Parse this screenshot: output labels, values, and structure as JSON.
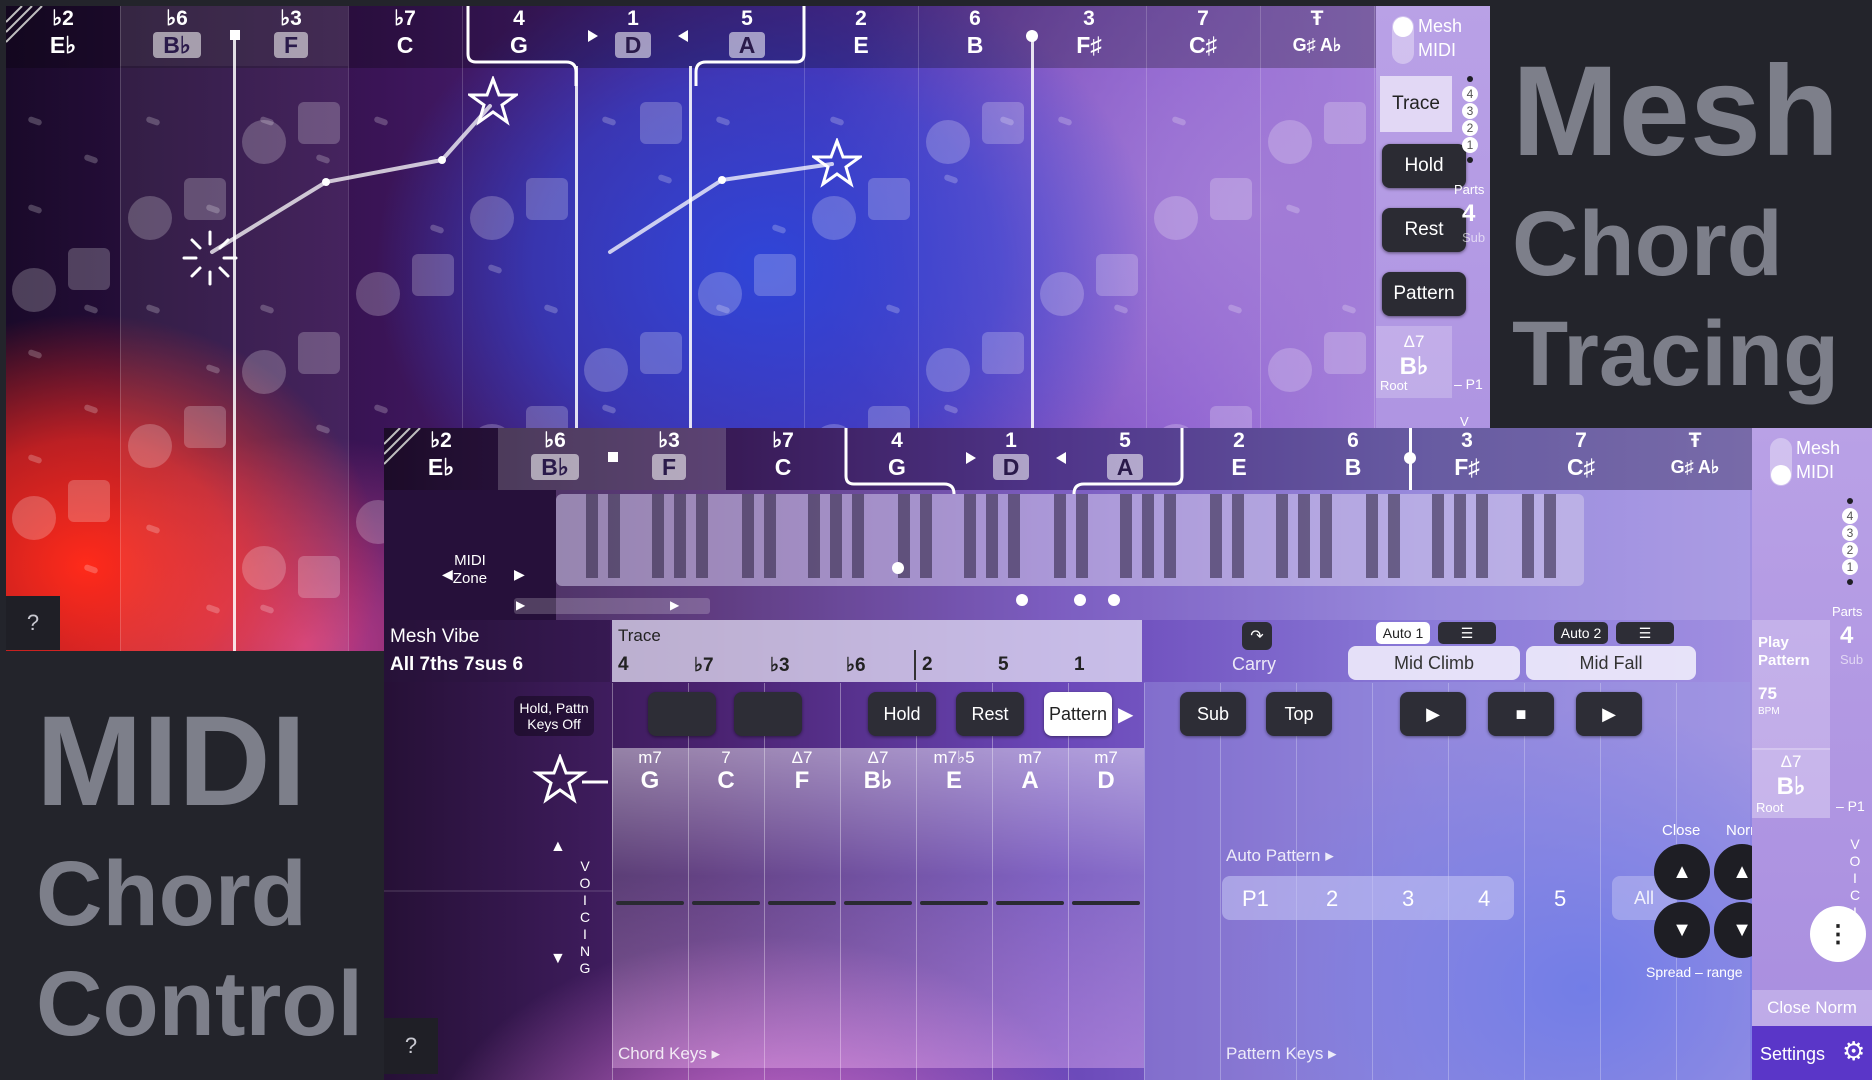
{
  "promo_top": {
    "line1": "Mesh",
    "line2": "Chord",
    "line3": "Tracing"
  },
  "promo_bottom": {
    "line1": "MIDI",
    "line2": "Chord",
    "line3": "Control"
  },
  "columns": [
    {
      "degree": "♭2",
      "note": "E♭",
      "boxed": false
    },
    {
      "degree": "♭6",
      "note": "B♭",
      "boxed": true
    },
    {
      "degree": "♭3",
      "note": "F",
      "boxed": true
    },
    {
      "degree": "♭7",
      "note": "C",
      "boxed": false
    },
    {
      "degree": "4",
      "note": "G",
      "boxed": false
    },
    {
      "degree": "1",
      "note": "D",
      "boxed": true
    },
    {
      "degree": "5",
      "note": "A",
      "boxed": true
    },
    {
      "degree": "2",
      "note": "E",
      "boxed": false
    },
    {
      "degree": "6",
      "note": "B",
      "boxed": false
    },
    {
      "degree": "3",
      "note": "F♯",
      "boxed": false
    },
    {
      "degree": "7",
      "note": "C♯",
      "boxed": false
    },
    {
      "degree": "Ŧ",
      "note": "G♯ A♭",
      "boxed": false
    }
  ],
  "top_sidebar": {
    "mesh": "Mesh",
    "midi": "MIDI",
    "trace": "Trace",
    "hold": "Hold",
    "rest": "Rest",
    "pattern": "Pattern",
    "parts_label": "Parts",
    "parts_value": "4",
    "sub": "Sub",
    "parts_numbers": [
      "4",
      "3",
      "2",
      "1"
    ],
    "root_quality": "Δ7",
    "root_note": "B♭",
    "root_label": "Root",
    "p1": "– P1",
    "v": "V"
  },
  "help": "?",
  "bottom": {
    "midi_zone": "MIDI Zone",
    "vibe_title": "Mesh Vibe",
    "vibe_value": "All 7ths 7sus 6",
    "hold_note": "Hold, Pattn Keys Off",
    "trace_label": "Trace",
    "trace_degrees": [
      "4",
      "♭7",
      "♭3",
      "♭6",
      "2",
      "5",
      "1"
    ],
    "buttons": {
      "hold": "Hold",
      "rest": "Rest",
      "pattern": "Pattern",
      "sub": "Sub",
      "top": "Top"
    },
    "carry": "Carry",
    "auto1": "Auto 1",
    "auto2": "Auto 2",
    "mid_climb": "Mid Climb",
    "mid_fall": "Mid Fall",
    "transport": {
      "play1": "▶",
      "stop": "■",
      "play2": "▶"
    },
    "chords": [
      {
        "q": "m7",
        "r": "G"
      },
      {
        "q": "7",
        "r": "C"
      },
      {
        "q": "Δ7",
        "r": "F"
      },
      {
        "q": "Δ7",
        "r": "B♭"
      },
      {
        "q": "m7♭5",
        "r": "E"
      },
      {
        "q": "m7",
        "r": "A"
      },
      {
        "q": "m7",
        "r": "D"
      }
    ],
    "voicing": [
      "V",
      "O",
      "I",
      "C",
      "I",
      "N",
      "G"
    ],
    "auto_pattern": "Auto Pattern ▸",
    "parts_row": [
      "P1",
      "2",
      "3",
      "4",
      "5"
    ],
    "all": "All",
    "chord_keys": "Chord Keys ▸",
    "pattern_keys": "Pattern Keys ▸",
    "close": "Close",
    "norm": "Norm",
    "spread": "Spread – range",
    "close_norm": "Close Norm",
    "settings": "Settings",
    "play_pattern": "Play Pattern",
    "bpm_value": "75",
    "bpm": "BPM",
    "parts_label": "Parts",
    "parts_value": "4",
    "sub": "Sub",
    "parts_numbers": [
      "4",
      "3",
      "2",
      "1"
    ],
    "root_quality": "Δ7",
    "root_note": "B♭",
    "root_label": "Root",
    "p1": "– P1",
    "mesh": "Mesh",
    "midi": "MIDI"
  },
  "colors": {
    "accent_white": "#ffffff",
    "button_dark": "#2d2d36",
    "promo_gray": "#7d7f8a"
  }
}
